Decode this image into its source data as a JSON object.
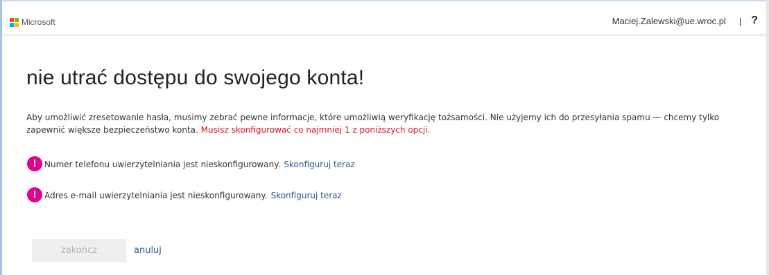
{
  "header": {
    "brand": "Microsoft",
    "user_email": "Maciej.Zalewski@ue.wroc.pl",
    "separator": "|",
    "help": "?"
  },
  "logo_colors": [
    "#f25022",
    "#7fba00",
    "#00a4ef",
    "#ffb900"
  ],
  "main": {
    "title": "nie utrać dostępu do swojego konta!",
    "intro": "Aby umożliwić zresetowanie hasła, musimy zebrać pewne informacje, które umożliwią weryfikację tożsamości. Nie użyjemy ich do przesyłania spamu — chcemy tylko zapewnić większe bezpieczeństwo konta.",
    "intro_required": "Musisz skonfigurować co najmniej 1 z poniższych opcji.",
    "items": [
      {
        "icon": "exclamation-icon",
        "text": "Numer telefonu uwierzytelniania jest nieskonfigurowany.",
        "link": "Skonfiguruj teraz"
      },
      {
        "icon": "exclamation-icon",
        "text": "Adres e-mail uwierzytelniania jest nieskonfigurowany.",
        "link": "Skonfiguruj teraz"
      }
    ],
    "warning_icon_glyph": "!",
    "finish_button": "zakończ",
    "cancel_link": "anuluj"
  },
  "colors": {
    "accent_link": "#2b5797",
    "required_text": "#e81123",
    "warning_icon": "#e3008c",
    "disabled_button_bg": "#efefef",
    "disabled_button_text": "#b4b4b4"
  }
}
